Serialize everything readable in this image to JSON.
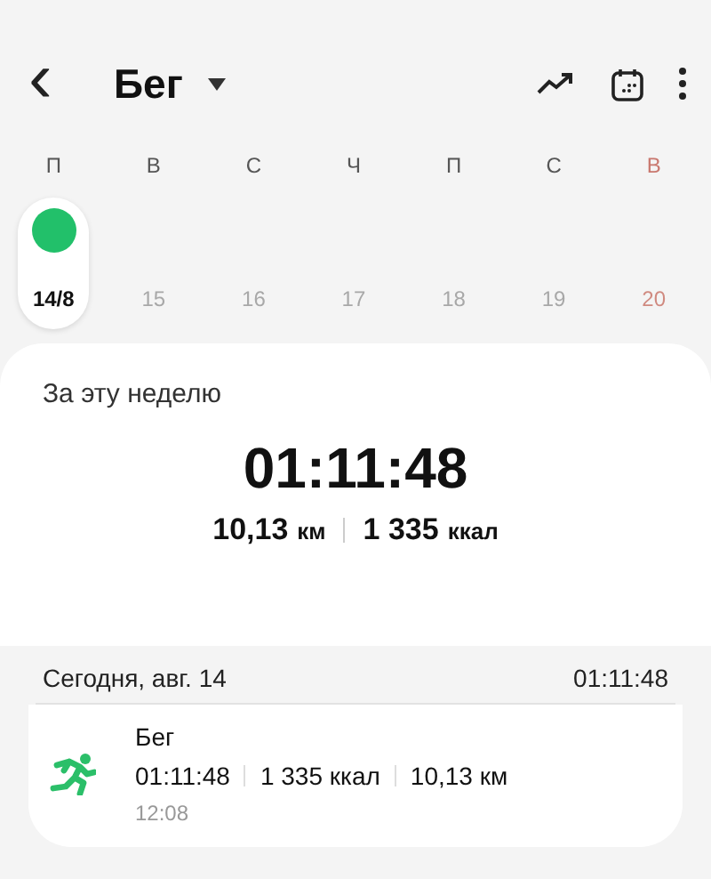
{
  "header": {
    "back": "‹",
    "title": "Бег"
  },
  "week": [
    {
      "weekday": "П",
      "date": "14/8",
      "selected": true,
      "has_workout": true,
      "future": false,
      "weekend": false
    },
    {
      "weekday": "В",
      "date": "15",
      "selected": false,
      "has_workout": false,
      "future": true,
      "weekend": false
    },
    {
      "weekday": "С",
      "date": "16",
      "selected": false,
      "has_workout": false,
      "future": true,
      "weekend": false
    },
    {
      "weekday": "Ч",
      "date": "17",
      "selected": false,
      "has_workout": false,
      "future": true,
      "weekend": false
    },
    {
      "weekday": "П",
      "date": "18",
      "selected": false,
      "has_workout": false,
      "future": true,
      "weekend": false
    },
    {
      "weekday": "С",
      "date": "19",
      "selected": false,
      "has_workout": false,
      "future": true,
      "weekend": false
    },
    {
      "weekday": "В",
      "date": "20",
      "selected": false,
      "has_workout": false,
      "future": true,
      "weekend": true
    }
  ],
  "summary": {
    "title": "За эту неделю",
    "duration": "01:11:48",
    "stats": [
      {
        "value": "10,13",
        "unit": "км"
      },
      {
        "value": "1 335",
        "unit": "ккал"
      }
    ]
  },
  "day": {
    "label": "Сегодня, авг. 14",
    "total": "01:11:48"
  },
  "entries": [
    {
      "name": "Бег",
      "stats": [
        "01:11:48",
        "1 335 ккал",
        "10,13 км"
      ],
      "time": "12:08"
    }
  ]
}
